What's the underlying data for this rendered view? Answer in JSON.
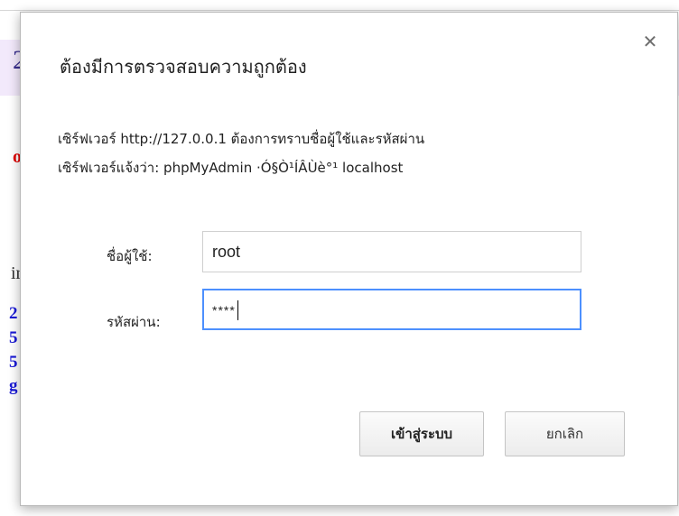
{
  "background": {
    "fragment_top": "2.",
    "fragment_red": "o",
    "fragment_mid": "ir",
    "links": [
      "2",
      "5",
      "5",
      "g"
    ]
  },
  "dialog": {
    "title": "ต้องมีการตรวจสอบความถูกต้อง",
    "message_line1": "เซิร์ฟเวอร์ http://127.0.0.1 ต้องการทราบชื่อผู้ใช้และรหัสผ่าน",
    "message_line2": "เซิร์ฟเวอร์แจ้งว่า: phpMyAdmin ·Ó§Ò¹ÍÂÙè°¹ localhost",
    "username_label": "ชื่อผู้ใช้:",
    "username_value": "root",
    "password_label": "รหัสผ่าน:",
    "password_value": "****",
    "login_button": "เข้าสู่ระบบ",
    "cancel_button": "ยกเลิก",
    "close_icon": "close-icon"
  }
}
